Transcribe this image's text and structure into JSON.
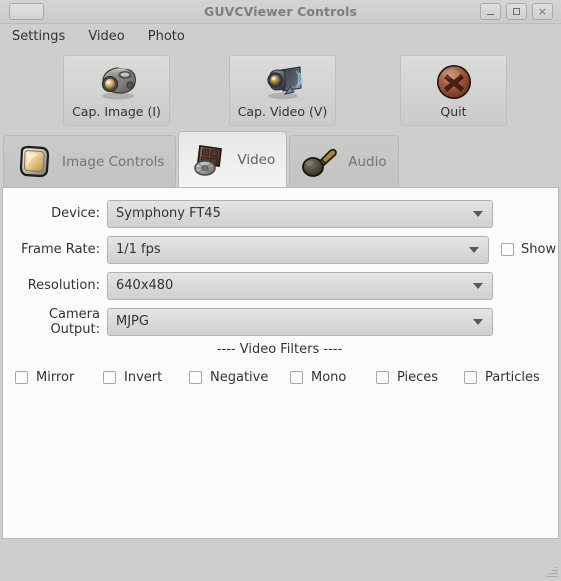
{
  "window": {
    "title": "GUVCViewer Controls",
    "buttons": {
      "minimize": "minimize-button",
      "maximize": "maximize-button",
      "close": "close-button"
    }
  },
  "menubar": {
    "items": [
      {
        "label": "Settings"
      },
      {
        "label": "Video"
      },
      {
        "label": "Photo"
      }
    ]
  },
  "toolbar": {
    "buttons": [
      {
        "label": "Cap. Image (I)",
        "icon": "photo-camera-icon"
      },
      {
        "label": "Cap. Video (V)",
        "icon": "video-camera-icon"
      },
      {
        "label": "Quit",
        "icon": "quit-cross-icon"
      }
    ]
  },
  "tabs": [
    {
      "label": "Image Controls",
      "icon": "monitor-icon",
      "active": false
    },
    {
      "label": "Video",
      "icon": "film-reel-icon",
      "active": true
    },
    {
      "label": "Audio",
      "icon": "microphone-icon",
      "active": false
    }
  ],
  "video_panel": {
    "fields": [
      {
        "label": "Device:",
        "value": "Symphony FT45"
      },
      {
        "label": "Frame Rate:",
        "value": "1/1 fps"
      },
      {
        "label": "Resolution:",
        "value": "640x480"
      },
      {
        "label": "Camera Output:",
        "value": "MJPG"
      }
    ],
    "show_checkbox": {
      "label": "Show",
      "checked": false
    },
    "filters_title": "---- Video Filters ----",
    "filters": [
      {
        "label": "Mirror",
        "checked": false
      },
      {
        "label": "Invert",
        "checked": false
      },
      {
        "label": "Negative",
        "checked": false
      },
      {
        "label": "Mono",
        "checked": false
      },
      {
        "label": "Pieces",
        "checked": false
      },
      {
        "label": "Particles",
        "checked": false
      }
    ]
  },
  "colors": {
    "window_bg": "#cecece",
    "panel_bg": "#fbfbfa",
    "text": "#2e3436",
    "title_text": "#7d7d7b",
    "tab_text": "#6f7577",
    "quit_red": "#9e4b33"
  }
}
